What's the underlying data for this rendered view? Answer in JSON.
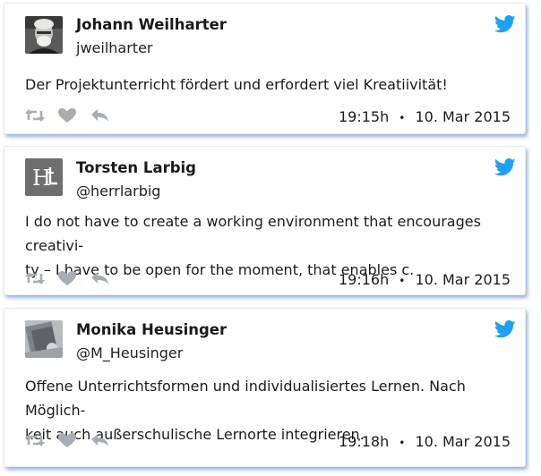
{
  "colors": {
    "accent": "#1da1f2",
    "action_icon": "#a7adb3",
    "shadow": "#7896cd"
  },
  "tweets": [
    {
      "name": "Johann Weilharter",
      "handle": "jweilharter",
      "text": "Der Projektunterricht fördert und erfordert viel Kreatiivität!",
      "time": "19:15h",
      "date": "10. Mar 2015",
      "separator": "•",
      "avatar": "photo-avatar"
    },
    {
      "name": "Torsten Larbig",
      "handle": "@herrlarbig",
      "text_line1": "I do not have to create a working environment that encourages creativi-",
      "text_line2": "ty – I have to be open for the moment, that enables c.",
      "time": "19:16h",
      "date": "10. Mar 2015",
      "separator": "•",
      "avatar": "monogram-avatar",
      "avatar_text": "H"
    },
    {
      "name": "Monika Heusinger",
      "handle": "@M_Heusinger",
      "text_line1": "Offene Unterrichtsformen und individualisiertes Lernen. Nach Möglich-",
      "text_line2": "keit auch außerschulische Lernorte integrieren.",
      "time": "19:18h",
      "date": "10. Mar 2015",
      "separator": "•",
      "avatar": "photo-avatar"
    }
  ],
  "icons": [
    "twitter-bird-icon",
    "retweet-icon",
    "like-heart-icon",
    "reply-icon"
  ]
}
